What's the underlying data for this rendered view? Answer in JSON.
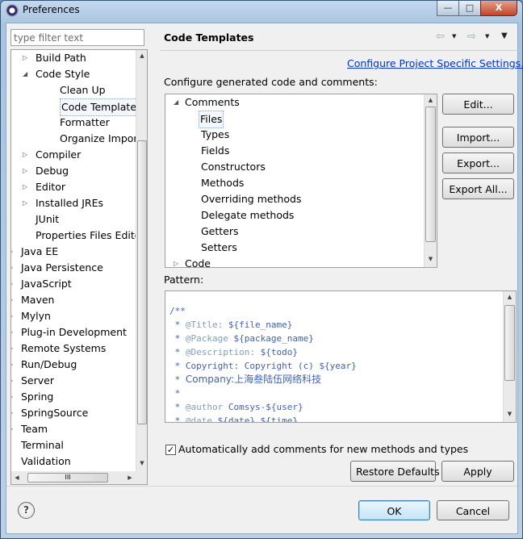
{
  "window": {
    "title": "Preferences",
    "minimize_glyph": "—",
    "maximize_glyph": "□",
    "close_glyph": "X"
  },
  "filter": {
    "placeholder": "type filter text"
  },
  "tree": {
    "items": [
      {
        "label": "Build Path",
        "twisty": "▷"
      },
      {
        "label": "Code Style",
        "twisty": "◢"
      },
      {
        "label": "Clean Up",
        "twisty": ""
      },
      {
        "label": "Code Templates",
        "twisty": ""
      },
      {
        "label": "Formatter",
        "twisty": ""
      },
      {
        "label": "Organize Imports",
        "twisty": ""
      },
      {
        "label": "Compiler",
        "twisty": "▷"
      },
      {
        "label": "Debug",
        "twisty": "▷"
      },
      {
        "label": "Editor",
        "twisty": "▷"
      },
      {
        "label": "Installed JREs",
        "twisty": "▷"
      },
      {
        "label": "JUnit",
        "twisty": ""
      },
      {
        "label": "Properties Files Editor",
        "twisty": ""
      },
      {
        "label": "Java EE",
        "twisty": "▷"
      },
      {
        "label": "Java Persistence",
        "twisty": "▷"
      },
      {
        "label": "JavaScript",
        "twisty": "▷"
      },
      {
        "label": "Maven",
        "twisty": "▷"
      },
      {
        "label": "Mylyn",
        "twisty": "▷"
      },
      {
        "label": "Plug-in Development",
        "twisty": "▷"
      },
      {
        "label": "Remote Systems",
        "twisty": "▷"
      },
      {
        "label": "Run/Debug",
        "twisty": "▷"
      },
      {
        "label": "Server",
        "twisty": "▷"
      },
      {
        "label": "Spring",
        "twisty": "▷"
      },
      {
        "label": "SpringSource",
        "twisty": "▷"
      },
      {
        "label": "Team",
        "twisty": "▷"
      },
      {
        "label": "Terminal",
        "twisty": ""
      },
      {
        "label": "Validation",
        "twisty": ""
      }
    ],
    "hscroll_grip": "III"
  },
  "page": {
    "title": "Code Templates",
    "back_glyph": "⇦",
    "forward_glyph": "⇨",
    "dropdown_glyph": "▼",
    "configure_link": "Configure Project Specific Settings...",
    "configure_label": "Configure generated code and comments:",
    "pattern_label": "Pattern:"
  },
  "templates": {
    "items": [
      {
        "label": "Comments",
        "twisty": "◢"
      },
      {
        "label": "Files",
        "twisty": ""
      },
      {
        "label": "Types",
        "twisty": ""
      },
      {
        "label": "Fields",
        "twisty": ""
      },
      {
        "label": "Constructors",
        "twisty": ""
      },
      {
        "label": "Methods",
        "twisty": ""
      },
      {
        "label": "Overriding methods",
        "twisty": ""
      },
      {
        "label": "Delegate methods",
        "twisty": ""
      },
      {
        "label": "Getters",
        "twisty": ""
      },
      {
        "label": "Setters",
        "twisty": ""
      },
      {
        "label": "Code",
        "twisty": "▷"
      }
    ]
  },
  "buttons": {
    "edit": "Edit...",
    "import": "Import...",
    "export": "Export...",
    "export_all": "Export All...",
    "restore_defaults": "Restore Defaults",
    "apply": "Apply",
    "ok": "OK",
    "cancel": "Cancel"
  },
  "pattern": {
    "lines": [
      {
        "prefix": "/**",
        "tag": "",
        "rest": ""
      },
      {
        "prefix": " * ",
        "tag": "@Title:",
        "rest": " ${file_name}"
      },
      {
        "prefix": " * ",
        "tag": "@Package",
        "rest": " ${package_name}"
      },
      {
        "prefix": " * ",
        "tag": "@Description:",
        "rest": " ${todo}"
      },
      {
        "prefix": " * ",
        "tag": "",
        "rest": "Copyright: Copyright (c) ${year}"
      },
      {
        "prefix": " * ",
        "tag": "",
        "rest": "Company:上海叁陆伍网络科技"
      },
      {
        "prefix": " * ",
        "tag": "",
        "rest": ""
      },
      {
        "prefix": " * ",
        "tag": "@author",
        "rest": " Comsys-${user}"
      },
      {
        "prefix": " * ",
        "tag": "@date",
        "rest": " ${date} ${time}"
      }
    ]
  },
  "auto_comments": {
    "checked": true,
    "check_glyph": "✓",
    "label": "Automatically add comments for new methods and types"
  },
  "help_glyph": "?"
}
